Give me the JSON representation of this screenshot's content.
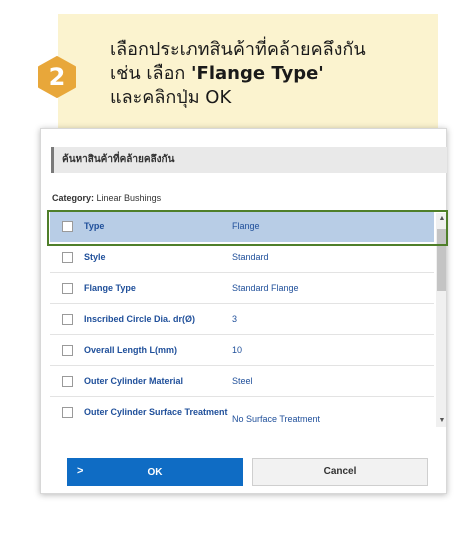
{
  "instruction": {
    "step_number": "2",
    "line1": "เลือกประเภทสินค้าที่คล้ายคลึงกัน",
    "line2_prefix": "เช่น เลือก ",
    "line2_highlight": "'Flange Type'",
    "line3": "และคลิกปุ่ม OK",
    "badge_color": "#e8a73a",
    "callout_bg": "#fbf3cf"
  },
  "dialog": {
    "header_title": "ค้นหาสินค้าที่คล้ายคลึงกัน",
    "category_label": "Category:",
    "category_value": "Linear Bushings",
    "rows": [
      {
        "attribute": "Type",
        "value": "Flange",
        "selected": true
      },
      {
        "attribute": "Style",
        "value": "Standard",
        "selected": false
      },
      {
        "attribute": "Flange Type",
        "value": "Standard Flange",
        "selected": false
      },
      {
        "attribute": "Inscribed Circle Dia. dr(Ø)",
        "value": "3",
        "selected": false
      },
      {
        "attribute": "Overall Length L(mm)",
        "value": "10",
        "selected": false
      },
      {
        "attribute": "Outer Cylinder Material",
        "value": "Steel",
        "selected": false
      },
      {
        "attribute": "Outer Cylinder Surface Treatment",
        "value": "No Surface Treatment",
        "selected": false
      }
    ],
    "ok_label": "OK",
    "cancel_label": "Cancel",
    "accent_color": "#0f6cc4",
    "selected_row_color": "#b8cde6",
    "highlight_border_color": "#4f7f2a"
  }
}
